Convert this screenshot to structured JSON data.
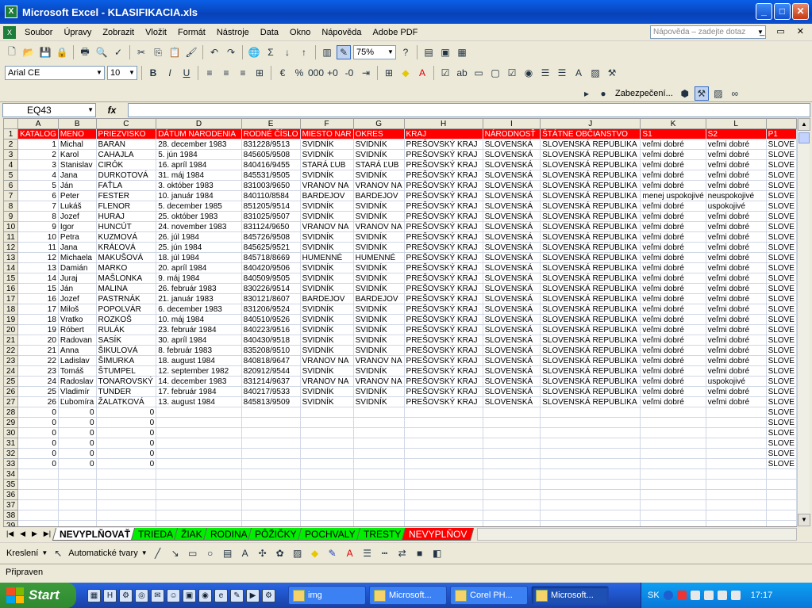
{
  "window": {
    "title": "Microsoft Excel - KLASIFIKACIA.xls"
  },
  "menu": {
    "items": [
      "Soubor",
      "Úpravy",
      "Zobrazit",
      "Vložit",
      "Formát",
      "Nástroje",
      "Data",
      "Okno",
      "Nápověda",
      "Adobe PDF"
    ],
    "help_placeholder": "Nápověda – zadejte dotaz"
  },
  "toolbar": {
    "zoom": "75%",
    "font": "Arial CE",
    "size": "10",
    "security_label": "Zabezpečení..."
  },
  "formula": {
    "name_box": "EQ43",
    "fx": "fx"
  },
  "sheet": {
    "columns": [
      "A",
      "B",
      "C",
      "D",
      "E",
      "F",
      "G",
      "H",
      "I",
      "J",
      "K",
      "L"
    ],
    "extra_col": "P1",
    "header_row": [
      "KATALOG",
      "MENO",
      "PRIEZVISKO",
      "DÁTUM NARODENIA",
      "RODNÉ ČÍSLO",
      "MIESTO NAR",
      "OKRES",
      "KRAJ",
      "NÁRODNOSŤ",
      "ŠTÁTNE OBČIANSTVO",
      "S1",
      "S2",
      "P1"
    ],
    "rows": [
      [
        "1",
        "Michal",
        "BARAN",
        "28. december 1983",
        "831228/9513",
        "SVIDNÍK",
        "SVIDNÍK",
        "PREŠOVSKÝ KRAJ",
        "SLOVENSKÁ",
        "SLOVENSKÁ REPUBLIKA",
        "veľmi dobré",
        "veľmi dobré",
        "SLOVE"
      ],
      [
        "2",
        "Karol",
        "CAHAJLA",
        "5. jún 1984",
        "845605/9508",
        "SVIDNÍK",
        "SVIDNÍK",
        "PREŠOVSKÝ KRAJ",
        "SLOVENSKÁ",
        "SLOVENSKÁ REPUBLIKA",
        "veľmi dobré",
        "veľmi dobré",
        "SLOVE"
      ],
      [
        "3",
        "Stanislav",
        "CIRÓK",
        "16. apríl 1984",
        "840416/9455",
        "STARÁ ĽUB",
        "STARÁ ĽUB",
        "PREŠOVSKÝ KRAJ",
        "SLOVENSKÁ",
        "SLOVENSKÁ REPUBLIKA",
        "veľmi dobré",
        "veľmi dobré",
        "SLOVE"
      ],
      [
        "4",
        "Jana",
        "DURKOTOVÁ",
        "31. máj 1984",
        "845531/9505",
        "SVIDNÍK",
        "SVIDNÍK",
        "PREŠOVSKÝ KRAJ",
        "SLOVENSKÁ",
        "SLOVENSKÁ REPUBLIKA",
        "veľmi dobré",
        "veľmi dobré",
        "SLOVE"
      ],
      [
        "5",
        "Ján",
        "FAŤLA",
        "3. október 1983",
        "831003/9650",
        "VRANOV NA",
        "VRANOV NA",
        "PREŠOVSKÝ KRAJ",
        "SLOVENSKÁ",
        "SLOVENSKÁ REPUBLIKA",
        "veľmi dobré",
        "veľmi dobré",
        "SLOVE"
      ],
      [
        "6",
        "Peter",
        "FESTER",
        "10. január 1984",
        "840110/8584",
        "BARDEJOV",
        "BARDEJOV",
        "PREŠOVSKÝ KRAJ",
        "SLOVENSKÁ",
        "SLOVENSKÁ REPUBLIKA",
        "menej uspokojivé",
        "neuspokojivé",
        "SLOVE"
      ],
      [
        "7",
        "Lukáš",
        "FLENOR",
        "5. december 1985",
        "851205/9514",
        "SVIDNÍK",
        "SVIDNÍK",
        "PREŠOVSKÝ KRAJ",
        "SLOVENSKÁ",
        "SLOVENSKÁ REPUBLIKA",
        "veľmi dobré",
        "uspokojivé",
        "SLOVE"
      ],
      [
        "8",
        "Jozef",
        "HURAJ",
        "25. október 1983",
        "831025/9507",
        "SVIDNÍK",
        "SVIDNÍK",
        "PREŠOVSKÝ KRAJ",
        "SLOVENSKÁ",
        "SLOVENSKÁ REPUBLIKA",
        "veľmi dobré",
        "veľmi dobré",
        "SLOVE"
      ],
      [
        "9",
        "Igor",
        "HUNCÚT",
        "24. november 1983",
        "831124/9650",
        "VRANOV NA",
        "VRANOV NA",
        "PREŠOVSKÝ KRAJ",
        "SLOVENSKÁ",
        "SLOVENSKÁ REPUBLIKA",
        "veľmi dobré",
        "veľmi dobré",
        "SLOVE"
      ],
      [
        "10",
        "Petra",
        "KUZMOVÁ",
        "26. júl 1984",
        "845726/9508",
        "SVIDNÍK",
        "SVIDNÍK",
        "PREŠOVSKÝ KRAJ",
        "SLOVENSKÁ",
        "SLOVENSKÁ REPUBLIKA",
        "veľmi dobré",
        "veľmi dobré",
        "SLOVE"
      ],
      [
        "11",
        "Jana",
        "KRÁĽOVÁ",
        "25. jún 1984",
        "845625/9521",
        "SVIDNÍK",
        "SVIDNÍK",
        "PREŠOVSKÝ KRAJ",
        "SLOVENSKÁ",
        "SLOVENSKÁ REPUBLIKA",
        "veľmi dobré",
        "veľmi dobré",
        "SLOVE"
      ],
      [
        "12",
        "Michaela",
        "MAKUŠOVÁ",
        "18. júl 1984",
        "845718/8669",
        "HUMENNÉ",
        "HUMENNÉ",
        "PREŠOVSKÝ KRAJ",
        "SLOVENSKÁ",
        "SLOVENSKÁ REPUBLIKA",
        "veľmi dobré",
        "veľmi dobré",
        "SLOVE"
      ],
      [
        "13",
        "Damián",
        "MARKO",
        "20. apríl 1984",
        "840420/9506",
        "SVIDNÍK",
        "SVIDNÍK",
        "PREŠOVSKÝ KRAJ",
        "SLOVENSKÁ",
        "SLOVENSKÁ REPUBLIKA",
        "veľmi dobré",
        "veľmi dobré",
        "SLOVE"
      ],
      [
        "14",
        "Juraj",
        "MAŠLONKA",
        "9. máj 1984",
        "840509/9505",
        "SVIDNÍK",
        "SVIDNÍK",
        "PREŠOVSKÝ KRAJ",
        "SLOVENSKÁ",
        "SLOVENSKÁ REPUBLIKA",
        "veľmi dobré",
        "veľmi dobré",
        "SLOVE"
      ],
      [
        "15",
        "Ján",
        "MALINA",
        "26. február 1983",
        "830226/9514",
        "SVIDNÍK",
        "SVIDNÍK",
        "PREŠOVSKÝ KRAJ",
        "SLOVENSKÁ",
        "SLOVENSKÁ REPUBLIKA",
        "veľmi dobré",
        "veľmi dobré",
        "SLOVE"
      ],
      [
        "16",
        "Jozef",
        "PASTRNÁK",
        "21. január 1983",
        "830121/8607",
        "BARDEJOV",
        "BARDEJOV",
        "PREŠOVSKÝ KRAJ",
        "SLOVENSKÁ",
        "SLOVENSKÁ REPUBLIKA",
        "veľmi dobré",
        "veľmi dobré",
        "SLOVE"
      ],
      [
        "17",
        "Miloš",
        "POPOLVÁR",
        "6. december 1983",
        "831206/9524",
        "SVIDNÍK",
        "SVIDNÍK",
        "PREŠOVSKÝ KRAJ",
        "SLOVENSKÁ",
        "SLOVENSKÁ REPUBLIKA",
        "veľmi dobré",
        "veľmi dobré",
        "SLOVE"
      ],
      [
        "18",
        "Vratko",
        "ROZKOŠ",
        "10. máj 1984",
        "840510/9526",
        "SVIDNÍK",
        "SVIDNÍK",
        "PREŠOVSKÝ KRAJ",
        "SLOVENSKÁ",
        "SLOVENSKÁ REPUBLIKA",
        "veľmi dobré",
        "veľmi dobré",
        "SLOVE"
      ],
      [
        "19",
        "Róbert",
        "RULÁK",
        "23. február 1984",
        "840223/9516",
        "SVIDNÍK",
        "SVIDNÍK",
        "PREŠOVSKÝ KRAJ",
        "SLOVENSKÁ",
        "SLOVENSKÁ REPUBLIKA",
        "veľmi dobré",
        "veľmi dobré",
        "SLOVE"
      ],
      [
        "20",
        "Radovan",
        "SASÍK",
        "30. apríl 1984",
        "840430/9518",
        "SVIDNÍK",
        "SVIDNÍK",
        "PREŠOVSKÝ KRAJ",
        "SLOVENSKÁ",
        "SLOVENSKÁ REPUBLIKA",
        "veľmi dobré",
        "veľmi dobré",
        "SLOVE"
      ],
      [
        "21",
        "Anna",
        "ŠIKULOVÁ",
        "8. február 1983",
        "835208/9510",
        "SVIDNÍK",
        "SVIDNÍK",
        "PREŠOVSKÝ KRAJ",
        "SLOVENSKÁ",
        "SLOVENSKÁ REPUBLIKA",
        "veľmi dobré",
        "veľmi dobré",
        "SLOVE"
      ],
      [
        "22",
        "Ladislav",
        "ŠIMURKA",
        "18. august 1984",
        "840818/9647",
        "VRANOV NA",
        "VRANOV NA",
        "PREŠOVSKÝ KRAJ",
        "SLOVENSKÁ",
        "SLOVENSKÁ REPUBLIKA",
        "veľmi dobré",
        "veľmi dobré",
        "SLOVE"
      ],
      [
        "23",
        "Tomáš",
        "ŠTUMPEL",
        "12. september 1982",
        "820912/9544",
        "SVIDNÍK",
        "SVIDNÍK",
        "PREŠOVSKÝ KRAJ",
        "SLOVENSKÁ",
        "SLOVENSKÁ REPUBLIKA",
        "veľmi dobré",
        "veľmi dobré",
        "SLOVE"
      ],
      [
        "24",
        "Radoslav",
        "TONAROVSKÝ",
        "14. december 1983",
        "831214/9637",
        "VRANOV NA",
        "VRANOV NA",
        "PREŠOVSKÝ KRAJ",
        "SLOVENSKÁ",
        "SLOVENSKÁ REPUBLIKA",
        "veľmi dobré",
        "uspokojivé",
        "SLOVE"
      ],
      [
        "25",
        "Vladimír",
        "TUNDER",
        "17. február 1984",
        "840217/9533",
        "SVIDNÍK",
        "SVIDNÍK",
        "PREŠOVSKÝ KRAJ",
        "SLOVENSKÁ",
        "SLOVENSKÁ REPUBLIKA",
        "veľmi dobré",
        "veľmi dobré",
        "SLOVE"
      ],
      [
        "26",
        "Ľubomíra",
        "ŽALATKOVÁ",
        "13. august 1984",
        "845813/9509",
        "SVIDNÍK",
        "SVIDNÍK",
        "PREŠOVSKÝ KRAJ",
        "SLOVENSKÁ",
        "SLOVENSKÁ REPUBLIKA",
        "veľmi dobré",
        "veľmi dobré",
        "SLOVE"
      ],
      [
        "0",
        "0",
        "0",
        "",
        "",
        "",
        "",
        "",
        "",
        "",
        "",
        "",
        "SLOVE"
      ],
      [
        "0",
        "0",
        "0",
        "",
        "",
        "",
        "",
        "",
        "",
        "",
        "",
        "",
        "SLOVE"
      ],
      [
        "0",
        "0",
        "0",
        "",
        "",
        "",
        "",
        "",
        "",
        "",
        "",
        "",
        "SLOVE"
      ],
      [
        "0",
        "0",
        "0",
        "",
        "",
        "",
        "",
        "",
        "",
        "",
        "",
        "",
        "SLOVE"
      ],
      [
        "0",
        "0",
        "0",
        "",
        "",
        "",
        "",
        "",
        "",
        "",
        "",
        "",
        "SLOVE"
      ],
      [
        "0",
        "0",
        "0",
        "",
        "",
        "",
        "",
        "",
        "",
        "",
        "",
        "",
        "SLOVE"
      ],
      [
        "",
        "",
        "",
        "",
        "",
        "",
        "",
        "",
        "",
        "",
        "",
        "",
        ""
      ],
      [
        "",
        "",
        "",
        "",
        "",
        "",
        "",
        "",
        "",
        "",
        "",
        "",
        ""
      ],
      [
        "",
        "",
        "",
        "",
        "",
        "",
        "",
        "",
        "",
        "",
        "",
        "",
        ""
      ],
      [
        "",
        "",
        "",
        "",
        "",
        "",
        "",
        "",
        "",
        "",
        "",
        "",
        ""
      ],
      [
        "",
        "",
        "",
        "",
        "",
        "",
        "",
        "",
        "",
        "",
        "",
        "",
        ""
      ],
      [
        "",
        "",
        "",
        "",
        "",
        "",
        "",
        "",
        "",
        "",
        "",
        "",
        ""
      ]
    ]
  },
  "sheet_tabs": [
    {
      "label": "NEVYPLŇOVAŤ",
      "style": "active"
    },
    {
      "label": "TRIEDA",
      "style": "green"
    },
    {
      "label": "ŽIAK",
      "style": "green"
    },
    {
      "label": "RODINA",
      "style": "green"
    },
    {
      "label": "PÔŽIČKY",
      "style": "green"
    },
    {
      "label": "POCHVALY",
      "style": "green"
    },
    {
      "label": "TRESTY",
      "style": "green"
    },
    {
      "label": "NEVYPLŇOV",
      "style": "red"
    }
  ],
  "drawing": {
    "kreslenie": "Kreslení",
    "autoshapes": "Automatické tvary"
  },
  "status": {
    "text": "Připraven"
  },
  "taskbar": {
    "start": "Start",
    "tasks": [
      {
        "label": "img",
        "active": false
      },
      {
        "label": "Microsoft...",
        "active": false
      },
      {
        "label": "Corel PH...",
        "active": false
      },
      {
        "label": "Microsoft...",
        "active": true
      }
    ],
    "lang": "SK",
    "clock": "17:17"
  }
}
